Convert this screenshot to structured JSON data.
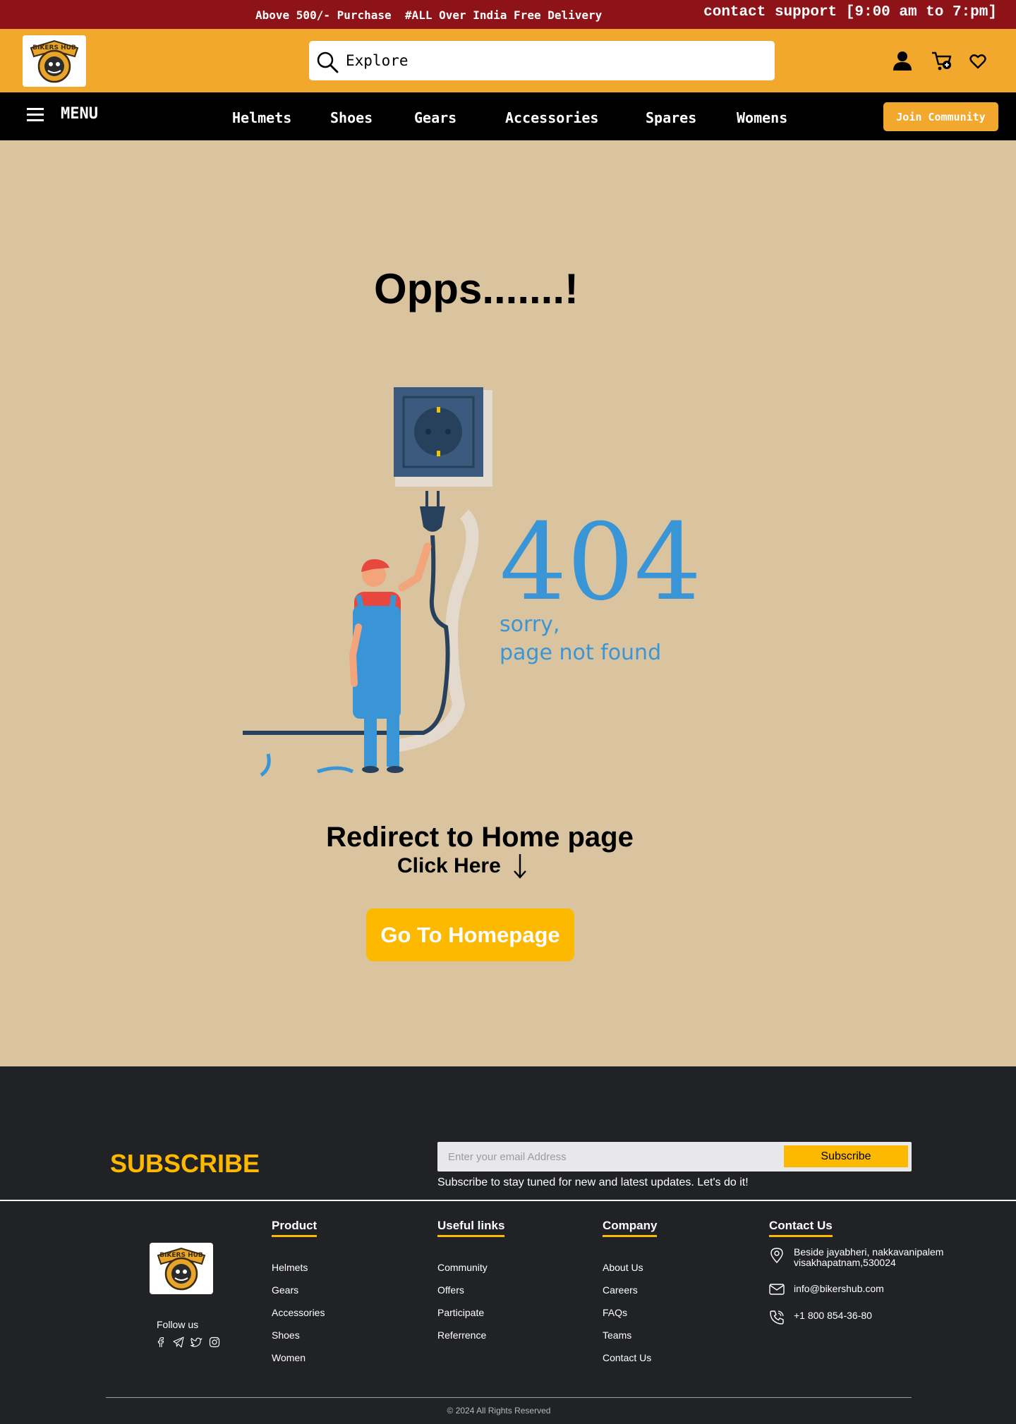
{
  "topbar": {
    "promo": "Above 500/- Purchase  #ALL Over India Free Delivery",
    "support": "contact support [9:00 am to 7:pm]"
  },
  "header": {
    "logo_text": "BIKERS HUB",
    "search_placeholder": "Explore"
  },
  "nav": {
    "menu_label": "MENU",
    "items": [
      "Helmets",
      "Shoes",
      "Gears",
      "Accessories",
      "Spares",
      "Womens"
    ],
    "join_label": "Join Community"
  },
  "main": {
    "title": "Opps.......!",
    "illustration": {
      "code": "404",
      "line1": "sorry,",
      "line2": "page not found"
    },
    "redirect": "Redirect to Home page",
    "click_here": "Click Here",
    "button": "Go To Homepage"
  },
  "footer": {
    "subscribe_title": "SUBSCRIBE",
    "email_placeholder": "Enter your email Address",
    "subscribe_button": "Subscribe",
    "subscribe_note": "Subscribe to stay tuned for new and latest updates. Let's do it!",
    "follow_us": "Follow us",
    "columns": [
      {
        "title": "Product",
        "links": [
          "Helmets",
          "Gears",
          "Accessories",
          "Shoes",
          "Women"
        ]
      },
      {
        "title": "Useful links",
        "links": [
          "Community",
          "Offers",
          "Participate",
          "Referrence"
        ]
      },
      {
        "title": "Company",
        "links": [
          "About Us",
          "Careers",
          "FAQs",
          "Teams",
          "Contact Us"
        ]
      }
    ],
    "contact": {
      "title": "Contact Us",
      "address": "Beside jayabheri, nakkavanipalem visakhapatnam,530024",
      "email": "info@bikershub.com",
      "phone": "+1 800 854-36-80"
    },
    "copyright": "© 2024 All Rights Reserved"
  },
  "colors": {
    "topbar": "#8e1318",
    "header": "#f2a82d",
    "page_bg": "#dac4a0",
    "accent_yellow": "#fcb900",
    "footer_bg": "#212226",
    "illustration_blue": "#3a95d6"
  },
  "icons": [
    "search-icon",
    "user-icon",
    "cart-icon",
    "heart-icon",
    "hamburger-icon",
    "arrow-down-icon",
    "facebook-icon",
    "telegram-icon",
    "twitter-icon",
    "instagram-icon",
    "location-icon",
    "mail-icon",
    "phone-icon"
  ]
}
